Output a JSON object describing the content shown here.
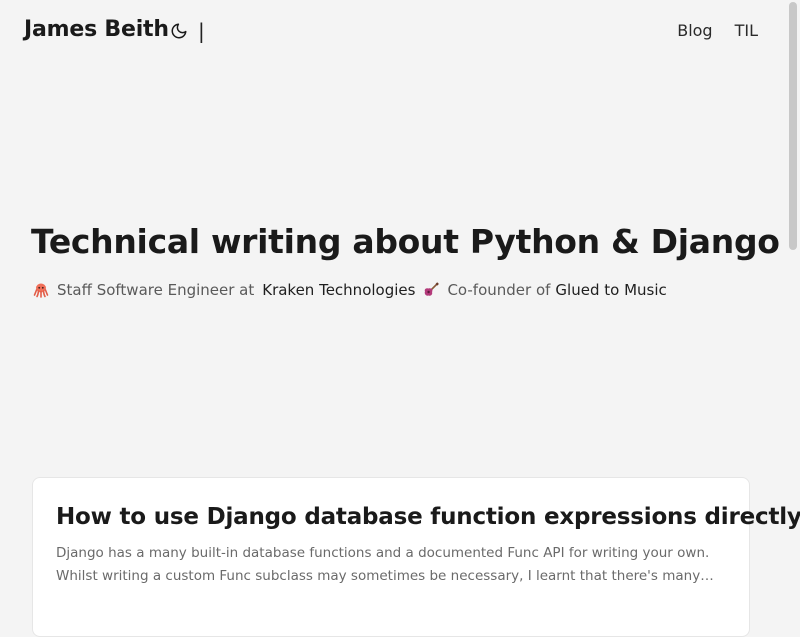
{
  "header": {
    "site_title": "James Beith",
    "theme_toggle_icon": "moon-icon",
    "separator": "|",
    "nav": [
      {
        "label": "Blog"
      },
      {
        "label": "TIL"
      }
    ]
  },
  "hero": {
    "title": "Technical writing about Python & Django",
    "role_icon": "octopus-icon",
    "role_text": "Staff Software Engineer at",
    "role_company": "Kraken Technologies",
    "cofounder_icon": "guitar-icon",
    "cofounder_text": "Co-founder of",
    "cofounder_company": "Glued to Music"
  },
  "posts": [
    {
      "title": "How to use Django database function expressions directly",
      "excerpt": "Django has a many built-in database functions and a documented Func API for writing your own. Whilst writing a custom Func subclass may sometimes be necessary, I learnt that there's many cases when you ca..."
    }
  ],
  "colors": {
    "background": "#f4f4f4",
    "card": "#ffffff",
    "text": "#1a1a1a",
    "muted": "#6a6a6a",
    "octopus": "#f0705a",
    "guitar": "#b33a7a"
  }
}
